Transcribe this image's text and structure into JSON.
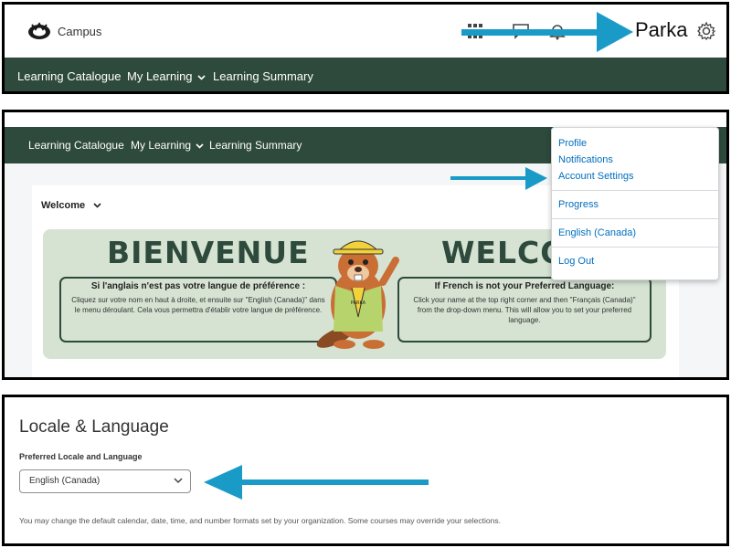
{
  "panel1": {
    "brand": "Campus",
    "user_name": "Parka",
    "icons": [
      "grid-icon",
      "chat-icon",
      "bell-icon",
      "gear-icon"
    ],
    "nav": [
      "Learning Catalogue",
      "My Learning",
      "Learning Summary"
    ]
  },
  "panel2": {
    "nav": [
      "Learning Catalogue",
      "My Learning",
      "Learning Summary"
    ],
    "welcome_select": "Welcome",
    "banner": {
      "fr_title": "BIENVENUE",
      "en_title": "WELCO",
      "fr_heading": "Si l'anglais n'est pas votre langue de préférence :",
      "fr_body": "Cliquez sur votre nom en haut à droite, et ensuite sur \"English (Canada)\" dans le menu déroulant. Cela vous permettra d'établir votre langue de préférence.",
      "en_heading": "If French is not your Preferred Language:",
      "en_body": "Click your name at the top right corner and then \"Français (Canada)\" from the drop-down menu. This will allow you to set your preferred language.",
      "mascot_badge": "PARKA"
    },
    "menu": {
      "profile": "Profile",
      "notifications": "Notifications",
      "account_settings": "Account Settings",
      "progress": "Progress",
      "language": "English (Canada)",
      "logout": "Log Out"
    }
  },
  "panel3": {
    "title": "Locale & Language",
    "field_label": "Preferred Locale and Language",
    "selected_value": "English (Canada)",
    "help_text": "You may change the default calendar, date, time, and number formats set by your organization. Some courses may override your selections."
  },
  "colors": {
    "nav_green": "#2e4a3c",
    "banner_green": "#d6e3d3",
    "link_blue": "#006fbf",
    "arrow_blue": "#1a9bc7"
  }
}
